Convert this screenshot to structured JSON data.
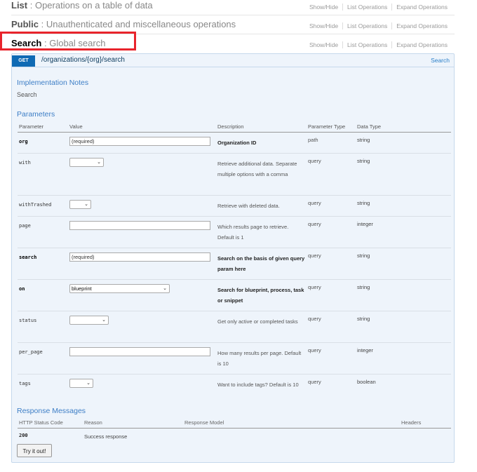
{
  "sections": {
    "list": {
      "name": "List",
      "desc": "Operations on a table of data"
    },
    "public": {
      "name": "Public",
      "desc": "Unauthenticated and miscellaneous operations"
    },
    "search": {
      "name": "Search",
      "desc": "Global search"
    },
    "actions": {
      "show_hide": "Show/Hide",
      "list_ops": "List Operations",
      "expand_ops": "Expand Operations"
    }
  },
  "operation": {
    "method": "GET",
    "path": "/organizations/{org}/search",
    "summary": "Search",
    "impl_notes_heading": "Implementation Notes",
    "impl_notes": "Search",
    "parameters_heading": "Parameters",
    "param_columns": {
      "parameter": "Parameter",
      "value": "Value",
      "description": "Description",
      "param_type": "Parameter Type",
      "data_type": "Data Type"
    },
    "params": [
      {
        "name": "org",
        "value": "(required)",
        "description": "Organization ID",
        "param_type": "path",
        "data_type": "string"
      },
      {
        "name": "with",
        "value": "",
        "description": "Retrieve additional data. Separate multiple options with a comma",
        "param_type": "query",
        "data_type": "string"
      },
      {
        "name": "withTrashed",
        "value": "",
        "description": "Retrieve with deleted data.",
        "param_type": "query",
        "data_type": "string"
      },
      {
        "name": "page",
        "value": "",
        "description": "Which results page to retrieve. Default is 1",
        "param_type": "query",
        "data_type": "integer"
      },
      {
        "name": "search",
        "value": "(required)",
        "description": "Search on the basis of given query param here",
        "param_type": "query",
        "data_type": "string"
      },
      {
        "name": "on",
        "value": "blueprint",
        "description": "Search for blueprint, process, task or snippet",
        "param_type": "query",
        "data_type": "string"
      },
      {
        "name": "status",
        "value": "",
        "description": "Get only active or completed tasks",
        "param_type": "query",
        "data_type": "string"
      },
      {
        "name": "per_page",
        "value": "",
        "description": "How many results per page. Default is 10",
        "param_type": "query",
        "data_type": "integer"
      },
      {
        "name": "tags",
        "value": "",
        "description": "Want to include tags? Default is 10",
        "param_type": "query",
        "data_type": "boolean"
      }
    ],
    "response_heading": "Response Messages",
    "response_columns": {
      "status": "HTTP Status Code",
      "reason": "Reason",
      "model": "Response Model",
      "headers": "Headers"
    },
    "responses": [
      {
        "code": "200",
        "reason": "Success response"
      }
    ],
    "try_button": "Try it out!"
  }
}
